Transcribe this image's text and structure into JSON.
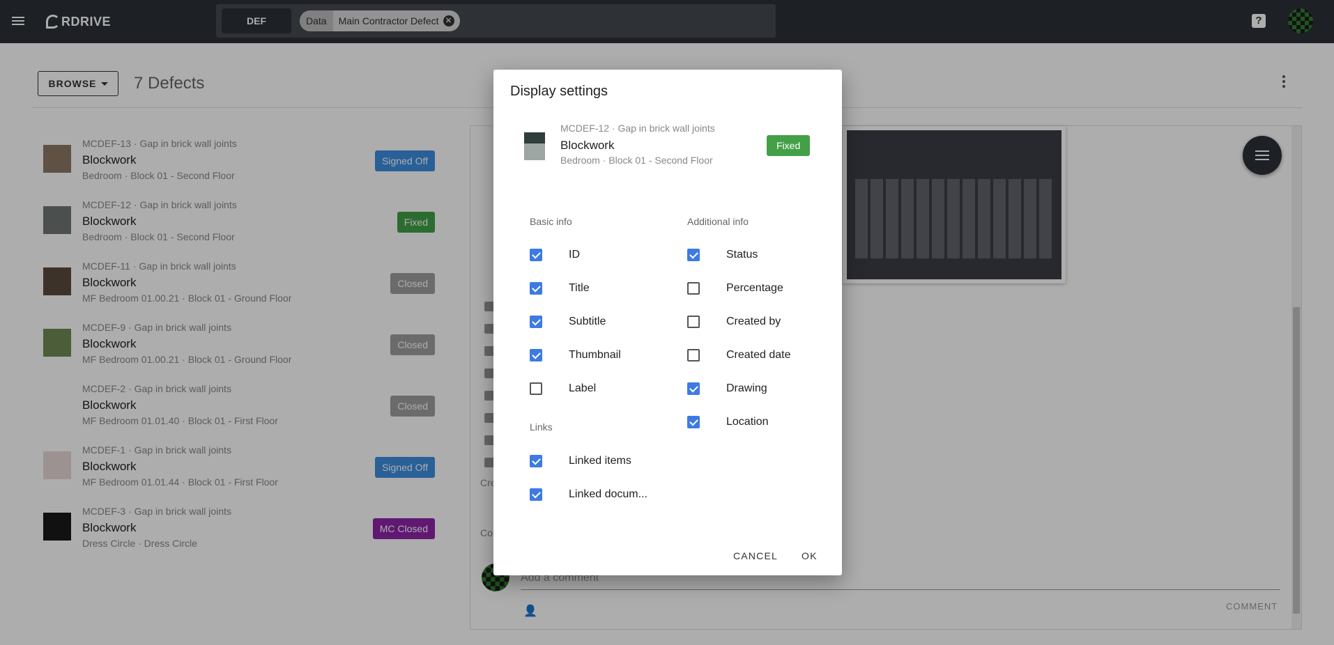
{
  "header": {
    "logo_text": "RDRIVE",
    "project_code": "DEF",
    "filter_chip": {
      "key": "Data",
      "value": "Main Contractor Defect"
    },
    "help_icon": "help-icon",
    "avatar_icon": "user-avatar"
  },
  "toolbar": {
    "browse_label": "BROWSE",
    "count_title": "7 Defects"
  },
  "defects": [
    {
      "id": "MCDEF-13 · Gap in brick wall joints",
      "title": "Blockwork",
      "subtitle": "Bedroom · Block 01 - Second Floor",
      "status": "Signed Off",
      "status_color": "#3d8ee0",
      "thumb": "#8c7a66"
    },
    {
      "id": "MCDEF-12 · Gap in brick wall joints",
      "title": "Blockwork",
      "subtitle": "Bedroom · Block 01 - Second Floor",
      "status": "Fixed",
      "status_color": "#43a047",
      "thumb": "#6f7573"
    },
    {
      "id": "MCDEF-11 · Gap in brick wall joints",
      "title": "Blockwork",
      "subtitle": "MF Bedroom 01.00.21 · Block 01 - Ground Floor",
      "status": "Closed",
      "status_color": "#9e9e9e",
      "thumb": "#5b4a3d"
    },
    {
      "id": "MCDEF-9 · Gap in brick wall joints",
      "title": "Blockwork",
      "subtitle": "MF Bedroom 01.00.21 · Block 01 - Ground Floor",
      "status": "Closed",
      "status_color": "#9e9e9e",
      "thumb": "#6f8a55"
    },
    {
      "id": "MCDEF-2 · Gap in brick wall joints",
      "title": "Blockwork",
      "subtitle": "MF Bedroom 01.01.40 · Block 01 - First Floor",
      "status": "Closed",
      "status_color": "#9e9e9e",
      "thumb": "#ffffff"
    },
    {
      "id": "MCDEF-1 · Gap in brick wall joints",
      "title": "Blockwork",
      "subtitle": "MF Bedroom 01.01.44 · Block 01 - First Floor",
      "status": "Signed Off",
      "status_color": "#3d8ee0",
      "thumb": "#e8d8d8"
    },
    {
      "id": "MCDEF-3 · Gap in brick wall joints",
      "title": "Blockwork",
      "subtitle": "Dress Circle · Dress Circle",
      "status": "MC Closed",
      "status_color": "#8e24aa",
      "thumb": "#1a1a1a"
    }
  ],
  "detail": {
    "cut_label_cre": "Cre",
    "cut_label_co": "Co",
    "comment_placeholder": "Add a comment",
    "comment_button": "COMMENT"
  },
  "dialog": {
    "title": "Display settings",
    "preview": {
      "id": "MCDEF-12 · Gap in brick wall joints",
      "title": "Blockwork",
      "subtitle": "Bedroom · Block 01 - Second Floor",
      "status": "Fixed"
    },
    "sections": {
      "basic": "Basic info",
      "additional": "Additional info",
      "links": "Links"
    },
    "basic": [
      {
        "label": "ID",
        "checked": true
      },
      {
        "label": "Title",
        "checked": true
      },
      {
        "label": "Subtitle",
        "checked": true
      },
      {
        "label": "Thumbnail",
        "checked": true
      },
      {
        "label": "Label",
        "checked": false
      }
    ],
    "additional": [
      {
        "label": "Status",
        "checked": true
      },
      {
        "label": "Percentage",
        "checked": false
      },
      {
        "label": "Created by",
        "checked": false
      },
      {
        "label": "Created date",
        "checked": false
      },
      {
        "label": "Drawing",
        "checked": true
      },
      {
        "label": "Location",
        "checked": true
      }
    ],
    "links": [
      {
        "label": "Linked items",
        "checked": true
      },
      {
        "label": "Linked docum...",
        "checked": true
      }
    ],
    "cancel_label": "CANCEL",
    "ok_label": "OK"
  }
}
